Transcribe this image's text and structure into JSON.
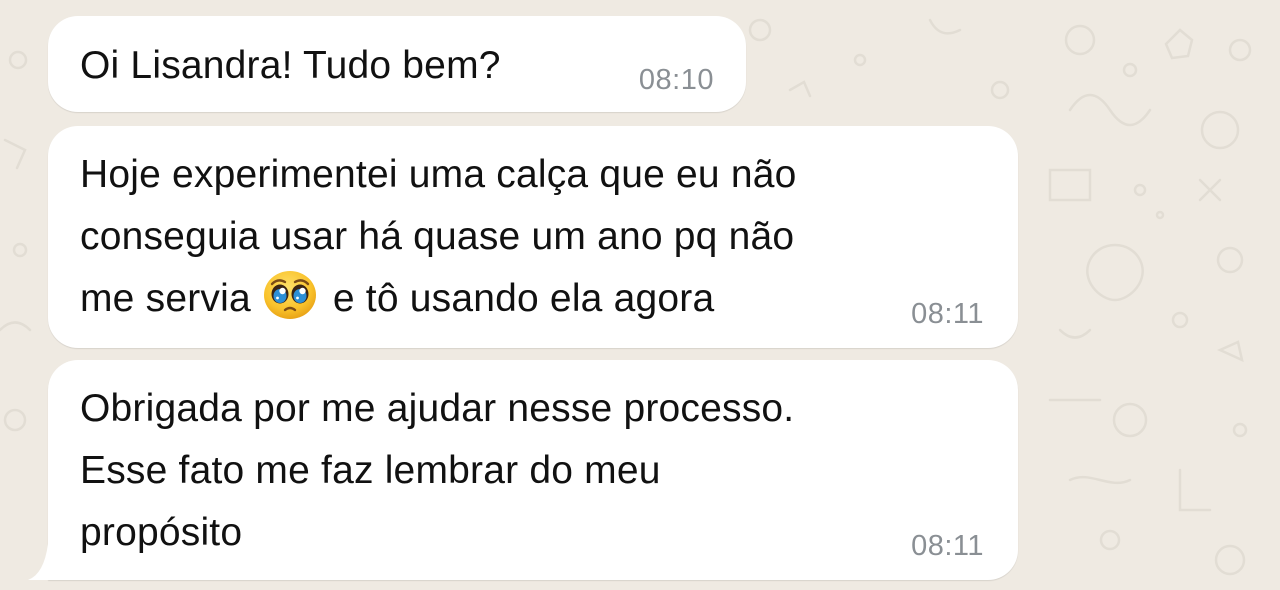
{
  "messages": [
    {
      "lines": [
        "Oi Lisandra! Tudo bem?"
      ],
      "time": "08:10"
    },
    {
      "lines": [
        "Hoje experimentei uma calça que eu não",
        "conseguia usar há quase um ano pq não",
        "me servia",
        "e tô usando ela agora"
      ],
      "emoji": "pleading-face-emoji",
      "time": "08:11"
    },
    {
      "lines": [
        "Obrigada por me ajudar nesse processo.",
        "Esse fato me faz lembrar do meu",
        "propósito"
      ],
      "time": "08:11"
    }
  ],
  "colors": {
    "background": "#efeae2",
    "bubble": "#ffffff",
    "text": "#111111",
    "timestamp": "#8a8f94"
  }
}
